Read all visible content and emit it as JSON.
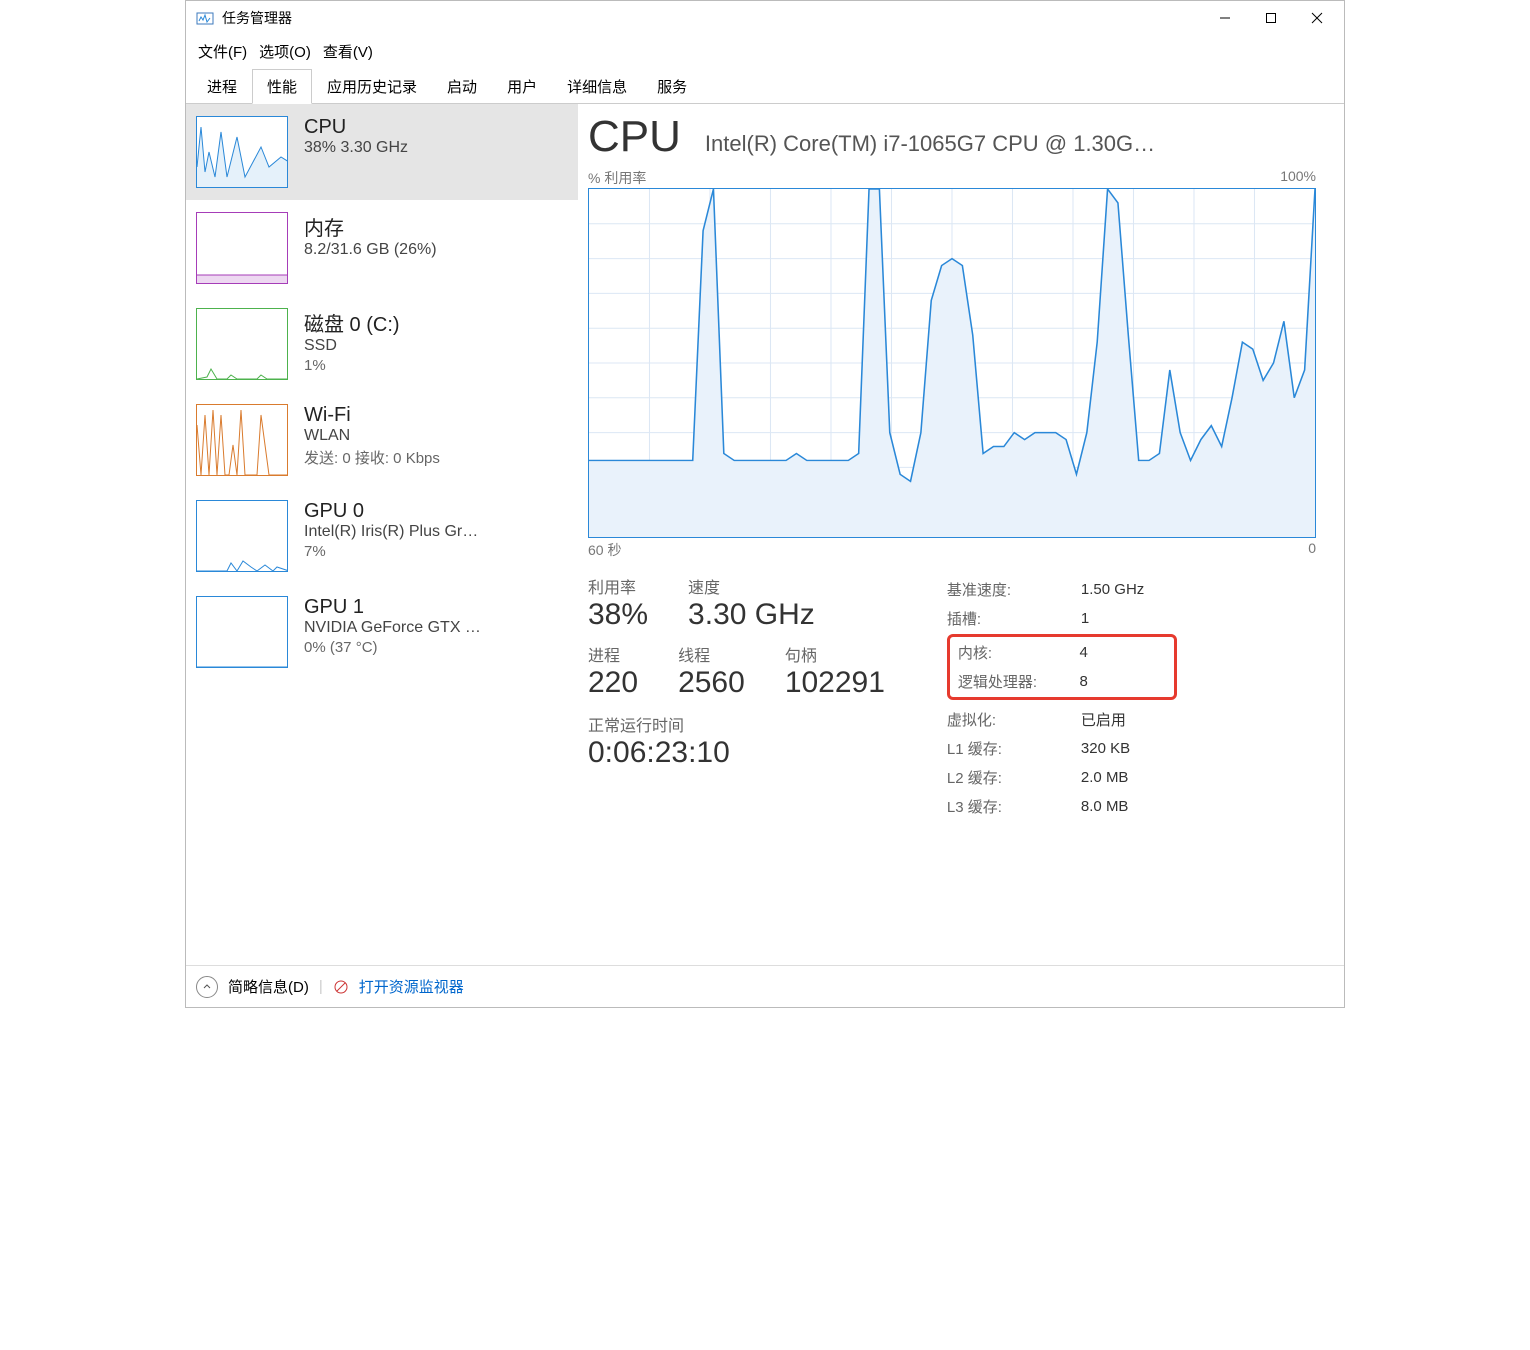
{
  "window": {
    "title": "任务管理器",
    "menu": {
      "file": "文件(F)",
      "options": "选项(O)",
      "view": "查看(V)"
    },
    "tabs": [
      "进程",
      "性能",
      "应用历史记录",
      "启动",
      "用户",
      "详细信息",
      "服务"
    ],
    "active_tab": "性能"
  },
  "sidebar": {
    "items": [
      {
        "key": "cpu",
        "name": "CPU",
        "sub": "38%  3.30 GHz",
        "selected": true,
        "color": "#2a88d8"
      },
      {
        "key": "mem",
        "name": "内存",
        "sub": "8.2/31.6 GB (26%)",
        "color": "#a63db8"
      },
      {
        "key": "disk",
        "name": "磁盘 0 (C:)",
        "sub": "SSD",
        "sub2": "1%",
        "color": "#4db24d"
      },
      {
        "key": "wifi",
        "name": "Wi-Fi",
        "sub": "WLAN",
        "sub2": "发送: 0 接收: 0 Kbps",
        "color": "#d97b2e"
      },
      {
        "key": "gpu0",
        "name": "GPU 0",
        "sub": "Intel(R) Iris(R) Plus Gr…",
        "sub2": "7%",
        "color": "#2a88d8"
      },
      {
        "key": "gpu1",
        "name": "GPU 1",
        "sub": "NVIDIA GeForce GTX …",
        "sub2": "0% (37 °C)",
        "color": "#2a88d8"
      }
    ]
  },
  "detail": {
    "title": "CPU",
    "model": "Intel(R) Core(TM) i7-1065G7 CPU @ 1.30G…",
    "graph_y_label": "% 利用率",
    "graph_y_max": "100%",
    "graph_x_left": "60 秒",
    "graph_x_right": "0",
    "stats1": [
      {
        "label": "利用率",
        "value": "38%"
      },
      {
        "label": "速度",
        "value": "3.30 GHz"
      }
    ],
    "stats2": [
      {
        "label": "进程",
        "value": "220"
      },
      {
        "label": "线程",
        "value": "2560"
      },
      {
        "label": "句柄",
        "value": "102291"
      }
    ],
    "uptime_label": "正常运行时间",
    "uptime_value": "0:06:23:10",
    "right_stats": [
      {
        "k": "基准速度:",
        "v": "1.50 GHz"
      },
      {
        "k": "插槽:",
        "v": "1"
      },
      {
        "k": "内核:",
        "v": "4",
        "hl": true
      },
      {
        "k": "逻辑处理器:",
        "v": "8",
        "hl": true
      },
      {
        "k": "虚拟化:",
        "v": "已启用"
      },
      {
        "k": "L1 缓存:",
        "v": "320 KB"
      },
      {
        "k": "L2 缓存:",
        "v": "2.0 MB"
      },
      {
        "k": "L3 缓存:",
        "v": "8.0 MB"
      }
    ]
  },
  "footer": {
    "fewer_details": "简略信息(D)",
    "resource_monitor": "打开资源监视器"
  },
  "chart_data": {
    "type": "line",
    "title": "% 利用率",
    "ylabel": "% 利用率",
    "ylim": [
      0,
      100
    ],
    "xlabel_left": "60 秒",
    "xlabel_right": "0",
    "values": [
      22,
      22,
      22,
      22,
      22,
      22,
      22,
      22,
      22,
      22,
      22,
      88,
      100,
      24,
      22,
      22,
      22,
      22,
      22,
      22,
      24,
      22,
      22,
      22,
      22,
      22,
      24,
      100,
      100,
      30,
      18,
      16,
      30,
      68,
      78,
      80,
      78,
      58,
      24,
      26,
      26,
      30,
      28,
      30,
      30,
      30,
      28,
      18,
      30,
      56,
      100,
      96,
      58,
      22,
      22,
      24,
      48,
      30,
      22,
      28,
      32,
      26,
      40,
      56,
      54,
      45,
      50,
      62,
      40,
      48,
      100
    ]
  }
}
